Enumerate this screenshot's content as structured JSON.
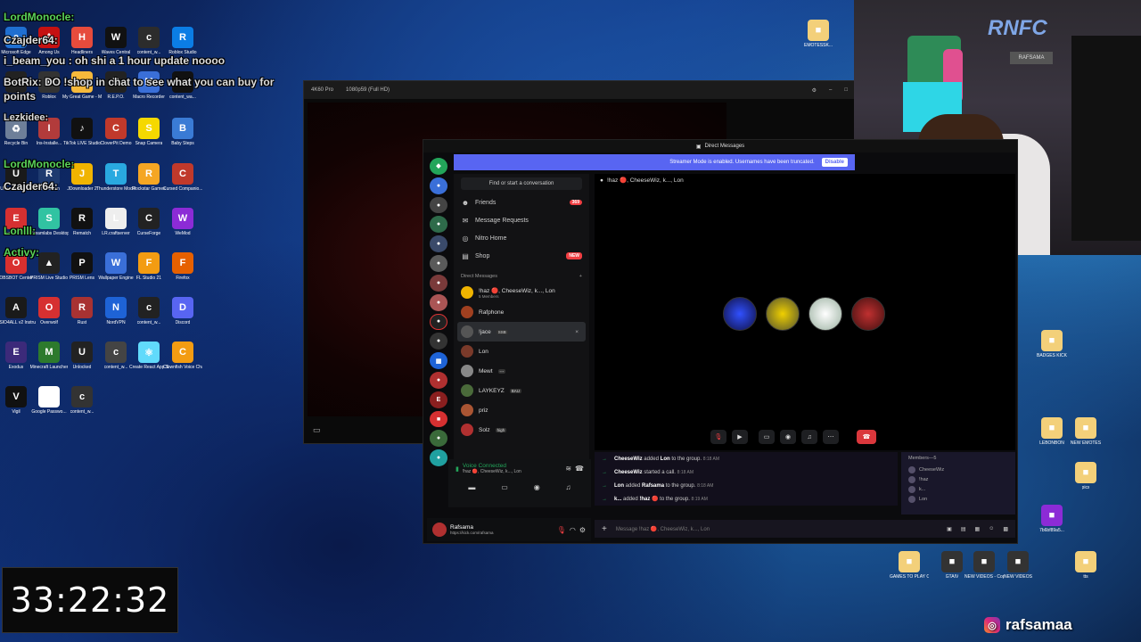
{
  "chat": {
    "line1_user": "LordMonocle:",
    "line2_user": "Czajder64:",
    "line3": "i_beam_you : oh shi a 1 hour update noooo",
    "line4": "BotRix: DO !shop in chat to see what you can buy for",
    "line5": "points",
    "line6_user": "Lezkidee:",
    "line7_user": "LordMonocle:",
    "line8_user": "Czajder64:",
    "line9_user": "Lonlll:",
    "line10_user": "Activy:"
  },
  "desktop_icons_left": [
    [
      "Microsoft Edge",
      "#1f6fd1",
      "e"
    ],
    [
      "Among Us",
      "#c51111",
      "A"
    ],
    [
      "Headliners",
      "#e64b3c",
      "H"
    ],
    [
      "Waves Central",
      "#111111",
      "W"
    ],
    [
      "content_w...",
      "#2c2c2c",
      "c"
    ],
    [
      "Roblox Studio",
      "#0b7de5",
      "R"
    ],
    [
      "OBS Studio",
      "#222",
      "●"
    ],
    [
      "Roblox",
      "#333",
      "■"
    ],
    [
      "My Great Game - My",
      "#f6b93b",
      "☺"
    ],
    [
      "R.E.P.O.",
      "#222",
      "R"
    ],
    [
      "Macro Recorder",
      "#3a6fd8",
      "M"
    ],
    [
      "content_wa...",
      "#111",
      "c"
    ],
    [
      "Recycle Bin",
      "#6e7f99",
      "♻"
    ],
    [
      "Ins-Installe...",
      "#b23b3b",
      "I"
    ],
    [
      "TikTok LIVE Studio",
      "#111",
      "♪"
    ],
    [
      "CloverPit Demo",
      "#c0392b",
      "C"
    ],
    [
      "Snap Camera",
      "#f5d800",
      "S"
    ],
    [
      "Baby Steps",
      "#3a7bd5",
      "B"
    ],
    [
      "Ubisoft Connect",
      "#1a1a1a",
      "U"
    ],
    [
      "r2modman",
      "#1e3a6f",
      "R"
    ],
    [
      "JDownloader 2",
      "#f0b400",
      "J"
    ],
    [
      "Thunderstore Mod Mana...",
      "#29a9e0",
      "T"
    ],
    [
      "Rockstar Games",
      "#f5a623",
      "R"
    ],
    [
      "Cursed Companio...",
      "#c0392b",
      "C"
    ],
    [
      "ExpressVPN",
      "#d63031",
      "E"
    ],
    [
      "Streamlabs Desktop",
      "#31c3a2",
      "S"
    ],
    [
      "Rematch",
      "#111",
      "R"
    ],
    [
      "LR.craftserver",
      "#eee",
      "L"
    ],
    [
      "CurseForge",
      "#222",
      "C"
    ],
    [
      "WeMod",
      "#8c2bd6",
      "W"
    ],
    [
      "OBSBOT Center",
      "#d9302f",
      "O"
    ],
    [
      "PRISM Live Studio",
      "#222",
      "▲"
    ],
    [
      "PRISM Lens",
      "#111",
      "P"
    ],
    [
      "Wallpaper Engine",
      "#3a6fd8",
      "W"
    ],
    [
      "FL Studio 21",
      "#f39c12",
      "F"
    ],
    [
      "Firefox",
      "#e66000",
      "F"
    ],
    [
      "ASIO4ALL v2 Instruction",
      "#1a1a1a",
      "A"
    ],
    [
      "Overwolf",
      "#d63031",
      "O"
    ],
    [
      "Rust",
      "#a83232",
      "R"
    ],
    [
      "NordVPN",
      "#1e63d6",
      "N"
    ],
    [
      "content_w...",
      "#222",
      "c"
    ],
    [
      "Discord",
      "#5865f2",
      "D"
    ],
    [
      "Exodus",
      "#3c2a7a",
      "E"
    ],
    [
      "Minecraft Launcher",
      "#2d7a2d",
      "M"
    ],
    [
      "Unlocked",
      "#222",
      "U"
    ],
    [
      "content_w...",
      "#444",
      "c"
    ],
    [
      "Create React App Sample",
      "#61dafb",
      "⚛"
    ],
    [
      "Clownfish Voice Changer",
      "#f39c12",
      "C"
    ],
    [
      "Vigil",
      "#111",
      "V"
    ],
    [
      "Google Passwo...",
      "#fff",
      "G"
    ],
    [
      "content_w...",
      "#333",
      "c"
    ]
  ],
  "desktop_icons_right": [
    [
      "EMOTESSK...",
      "#f3d07a",
      "■"
    ],
    [
      "BADGES KICK",
      "#f3d07a",
      "■"
    ],
    [
      "LEBONBON",
      "#f3d07a",
      "■"
    ],
    [
      "NEW EMOTES",
      "#f3d07a",
      "■"
    ],
    [
      "pics",
      "#f3d07a",
      "■"
    ],
    [
      "7b6bf89a5...",
      "#8c2bd6",
      "■"
    ],
    [
      "GAMES TO PLAY ON...",
      "#f3d07a",
      "■"
    ],
    [
      "GTAIV",
      "#333",
      "■"
    ],
    [
      "NEW VIDEOS - Copy",
      "#333",
      "■"
    ],
    [
      "NEW VIDEOS",
      "#333",
      "■"
    ],
    [
      "tts",
      "#f3d07a",
      "■"
    ]
  ],
  "capture": {
    "device": "4K60 Pro",
    "resolution": "1080p59 (Full HD)"
  },
  "discord": {
    "title": "Direct Messages",
    "banner_text": "Streamer Mode is enabled. Usernames have been truncated.",
    "banner_button": "Disable",
    "search_placeholder": "Find or start a conversation",
    "nav": {
      "friends": "Friends",
      "friends_badge": "369",
      "message_requests": "Message Requests",
      "nitro_home": "Nitro Home",
      "shop": "Shop",
      "shop_badge": "NEW"
    },
    "dm_header": "Direct Messages",
    "dms": [
      {
        "name": "!haz 🔴, CheeseWiz, k..., Lon",
        "sub": "5 Members",
        "color": "#f0b400"
      },
      {
        "name": "Rafphone",
        "sub": "",
        "color": "#a04020"
      },
      {
        "name": "!jace",
        "sub": "",
        "color": "#555555",
        "tag": "SSB"
      },
      {
        "name": "Lon",
        "sub": "",
        "color": "#7a3a2a"
      },
      {
        "name": "Mewt",
        "sub": "",
        "color": "#888888",
        "tag": "◦◦◦"
      },
      {
        "name": "LAYKEYZ",
        "sub": "",
        "color": "#4a6a3a",
        "tag": "BAU"
      },
      {
        "name": "priz",
        "sub": "",
        "color": "#aa5533"
      },
      {
        "name": "Solz",
        "sub": "",
        "color": "#b03030",
        "tag": "high"
      }
    ],
    "voice": {
      "status": "Voice Connected",
      "channel": "!haz 🔴, CheeseWiz, k..., Lon"
    },
    "user": {
      "name": "Rafsama",
      "status": "https://kick.com/rafsama"
    },
    "main_header": "!haz 🔴, CheeseWiz, k..., Lon",
    "messages": [
      {
        "actor": "CheeseWiz",
        "text": " added ",
        "target": "Lon",
        "rest": " to the group.",
        "time": "8:18 AM"
      },
      {
        "actor": "CheeseWiz",
        "text": " started a call.",
        "target": "",
        "rest": "",
        "time": "8:18 AM"
      },
      {
        "actor": "Lon",
        "text": " added ",
        "target": "Rafsama",
        "rest": " to the group.",
        "time": "8:18 AM"
      },
      {
        "actor": "k...",
        "text": " added ",
        "target": "!haz 🔴",
        "rest": " to the group.",
        "time": "8:19 AM"
      }
    ],
    "members_header": "Members—5",
    "members": [
      "CheeseWiz",
      "!haz",
      "k...",
      "Lon"
    ],
    "input_placeholder": "Message !haz 🔴, CheeseWiz, k..., Lon",
    "accent": "#5865f2"
  },
  "timer": "33:22:32",
  "handle": "rafsamaa"
}
